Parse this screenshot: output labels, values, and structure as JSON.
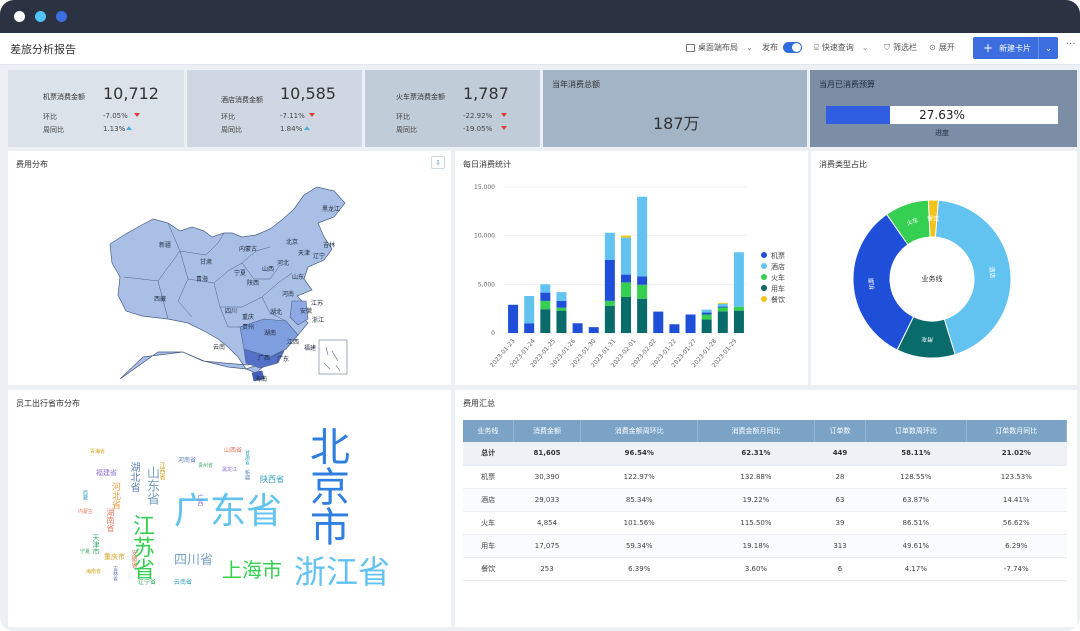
{
  "window": {
    "dots": [
      "#ffffff",
      "#52c3f5",
      "#3d6ee0"
    ]
  },
  "toolbar": {
    "report_title": "差旅分析报告",
    "layout_label": "桌面端布局",
    "publish_label": "发布",
    "quick_query_label": "快速查询",
    "filter_label": "筛选栏",
    "expand_label": "展开",
    "new_card_label": "新建卡片",
    "more_label": "···"
  },
  "kpis": [
    {
      "name": "机票消费金额",
      "value": "10,712",
      "mom_label": "环比",
      "mom": "-7.05%",
      "mom_dir": "down",
      "yoy_label": "周同比",
      "yoy": "1.13%",
      "yoy_dir": "up"
    },
    {
      "name": "酒店消费金额",
      "value": "10,585",
      "mom_label": "环比",
      "mom": "-7.11%",
      "mom_dir": "down",
      "yoy_label": "周同比",
      "yoy": "1.84%",
      "yoy_dir": "up"
    },
    {
      "name": "火车票消费金额",
      "value": "1,787",
      "mom_label": "环比",
      "mom": "-22.92%",
      "mom_dir": "down",
      "yoy_label": "周同比",
      "yoy": "-19.05%",
      "yoy_dir": "down"
    }
  ],
  "annual": {
    "title": "当年消费总额",
    "value": "187万"
  },
  "budget": {
    "title": "当月已消费预算",
    "value": "27.63%",
    "progress": 0.2763,
    "caption": "进度"
  },
  "map_panel": {
    "title": "费用分布"
  },
  "map_labels": [
    "新疆",
    "西藏",
    "青海",
    "甘肃",
    "内蒙古",
    "黑龙江",
    "吉林",
    "辽宁",
    "北京",
    "天津",
    "河北",
    "山西",
    "陕西",
    "宁夏",
    "四川",
    "重庆",
    "云南",
    "贵州",
    "广西",
    "广东",
    "湖南",
    "湖北",
    "河南",
    "山东",
    "江西",
    "安徽",
    "浙江",
    "福建",
    "江苏",
    "海南"
  ],
  "daily_panel": {
    "title": "每日消费统计"
  },
  "donut_panel": {
    "title": "消费类型占比"
  },
  "wordcloud_panel": {
    "title": "员工出行省市分布"
  },
  "summary_panel": {
    "title": "费用汇总"
  },
  "colors": {
    "flight": "#1f4fd8",
    "hotel": "#63c3f0",
    "train": "#35d052",
    "car": "#0a6b6b",
    "meal": "#f0c419"
  },
  "chart_data": [
    {
      "type": "bar",
      "stacked": true,
      "title": "每日消费统计",
      "categories": [
        "2023-01-23",
        "2023-01-24",
        "2023-01-25",
        "2023-01-26",
        "2023-01-27",
        "2023-01-30",
        "2023-01-31",
        "2023-02-01",
        "2023-02-02",
        "2023-01-20",
        "2023-01-22",
        "2023-01-21",
        "2023-01-27",
        "2023-01-28",
        "2023-01-29"
      ],
      "x_tick_labels": [
        "2023-01-23",
        "2023-01-24",
        "2023-01-25",
        "2023-01-26",
        "2023-01-30",
        "2023-01-31",
        "2023-02-01",
        "2023-02-02",
        "2023-01-22",
        "2023-01-27",
        "2023-01-28",
        "2023-01-29"
      ],
      "series": [
        {
          "name": "机票",
          "values": [
            2900,
            1000,
            800,
            700,
            0,
            0,
            4200,
            800,
            900,
            0,
            0,
            0,
            200,
            100,
            0
          ]
        },
        {
          "name": "酒店",
          "values": [
            0,
            2800,
            800,
            900,
            0,
            0,
            2800,
            3800,
            8600,
            0,
            0,
            0,
            300,
            300,
            5600
          ]
        },
        {
          "name": "火车",
          "values": [
            0,
            0,
            800,
            300,
            0,
            0,
            500,
            1500,
            1500,
            0,
            0,
            0,
            500,
            400,
            400
          ]
        },
        {
          "name": "用车",
          "values": [
            0,
            0,
            2300,
            2300,
            0,
            0,
            2800,
            3700,
            3700,
            0,
            0,
            0,
            1400,
            2300,
            2300
          ]
        },
        {
          "name": "餐饮",
          "values": [
            0,
            0,
            0,
            0,
            0,
            0,
            0,
            200,
            0,
            0,
            0,
            0,
            0,
            100,
            0
          ]
        }
      ],
      "bar_totals": [
        2900,
        3800,
        5000,
        4200,
        1000,
        600,
        10300,
        10000,
        14000,
        2200,
        900,
        1900,
        2400,
        3100,
        8300
      ],
      "yticks": [
        0,
        5000,
        10000,
        15000
      ],
      "ytick_labels": [
        "0",
        "5,000",
        "10,000",
        "15,000"
      ],
      "ylim": [
        0,
        15000
      ],
      "legend_placement": "right",
      "grid": true
    },
    {
      "type": "pie",
      "variant": "donut",
      "title": "消费类型占比",
      "center_label": "业务线",
      "categories": [
        "酒店",
        "用车",
        "机票",
        "火车",
        "餐饮"
      ],
      "slice_labels": [
        "酒店",
        "用车",
        "机票",
        "火车",
        "餐饮"
      ],
      "values": [
        44,
        12,
        33,
        9,
        2
      ]
    },
    {
      "type": "table",
      "title": "费用汇总",
      "columns": [
        "业务线",
        "消费金额",
        "消费金额周环比",
        "消费金额月同比",
        "订单数",
        "订单数周环比",
        "订单数月同比"
      ],
      "rows": [
        [
          "总计",
          "81,605",
          "96.54%",
          "62.31%",
          "449",
          "58.11%",
          "21.02%"
        ],
        [
          "机票",
          "30,390",
          "122.97%",
          "132.88%",
          "28",
          "128.55%",
          "123.53%"
        ],
        [
          "酒店",
          "29,033",
          "85.34%",
          "19.22%",
          "63",
          "63.87%",
          "14.41%"
        ],
        [
          "火车",
          "4,854",
          "101.56%",
          "115.50%",
          "39",
          "86.51%",
          "56.62%"
        ],
        [
          "用车",
          "17,075",
          "59.34%",
          "19.18%",
          "313",
          "49.61%",
          "6.29%"
        ],
        [
          "餐饮",
          "253",
          "6.39%",
          "3.60%",
          "6",
          "4.17%",
          "-7.74%"
        ]
      ]
    }
  ],
  "wordcloud": [
    {
      "text": "北京市",
      "color": "#2f7fe0",
      "vertical": true,
      "size": 40
    },
    {
      "text": "广东省",
      "color": "#63c3f0",
      "vertical": false,
      "size": 36
    },
    {
      "text": "浙江省",
      "color": "#63c3f0",
      "vertical": false,
      "size": 32
    },
    {
      "text": "上海市",
      "color": "#35d052",
      "vertical": false,
      "size": 20
    },
    {
      "text": "江苏省",
      "color": "#35d052",
      "vertical": true,
      "size": 22
    },
    {
      "text": "四川省",
      "color": "#7aa3c6",
      "vertical": false,
      "size": 13
    },
    {
      "text": "山东省",
      "color": "#7aa3c6",
      "vertical": true,
      "size": 13
    },
    {
      "text": "湖北省",
      "color": "#5b7fb5",
      "vertical": true,
      "size": 10
    },
    {
      "text": "河北省",
      "color": "#f0a040",
      "vertical": true,
      "size": 9
    },
    {
      "text": "陕西省",
      "color": "#35a0c0",
      "vertical": false,
      "size": 8
    },
    {
      "text": "湖南省",
      "color": "#e07a5f",
      "vertical": true,
      "size": 8
    },
    {
      "text": "福建省",
      "color": "#8a6fd1",
      "vertical": false,
      "size": 7
    },
    {
      "text": "天津市",
      "color": "#3aa76d",
      "vertical": true,
      "size": 7
    },
    {
      "text": "重庆市",
      "color": "#d4a017",
      "vertical": false,
      "size": 7
    },
    {
      "text": "河南省",
      "color": "#5b7fb5",
      "vertical": false,
      "size": 6
    },
    {
      "text": "安徽省",
      "color": "#e07a5f",
      "vertical": true,
      "size": 6
    },
    {
      "text": "辽宁省",
      "color": "#3aa76d",
      "vertical": false,
      "size": 6
    },
    {
      "text": "江西省",
      "color": "#d4a017",
      "vertical": true,
      "size": 6
    },
    {
      "text": "云南省",
      "color": "#35a0c0",
      "vertical": false,
      "size": 6
    },
    {
      "text": "广西",
      "color": "#8a6fd1",
      "vertical": true,
      "size": 6
    },
    {
      "text": "山西省",
      "color": "#e07a5f",
      "vertical": false,
      "size": 6
    },
    {
      "text": "吉林省",
      "color": "#5b7fb5",
      "vertical": true,
      "size": 5
    },
    {
      "text": "贵州省",
      "color": "#3aa76d",
      "vertical": false,
      "size": 5
    },
    {
      "text": "海南省",
      "color": "#d4a017",
      "vertical": false,
      "size": 5
    },
    {
      "text": "甘肃省",
      "color": "#35a0c0",
      "vertical": true,
      "size": 5
    },
    {
      "text": "内蒙古",
      "color": "#e07a5f",
      "vertical": false,
      "size": 5
    },
    {
      "text": "黑龙江",
      "color": "#8a6fd1",
      "vertical": false,
      "size": 5
    },
    {
      "text": "新疆",
      "color": "#5b7fb5",
      "vertical": true,
      "size": 5
    },
    {
      "text": "宁夏",
      "color": "#3aa76d",
      "vertical": false,
      "size": 5
    },
    {
      "text": "青海省",
      "color": "#d4a017",
      "vertical": false,
      "size": 5
    },
    {
      "text": "西藏",
      "color": "#35a0c0",
      "vertical": true,
      "size": 5
    }
  ]
}
